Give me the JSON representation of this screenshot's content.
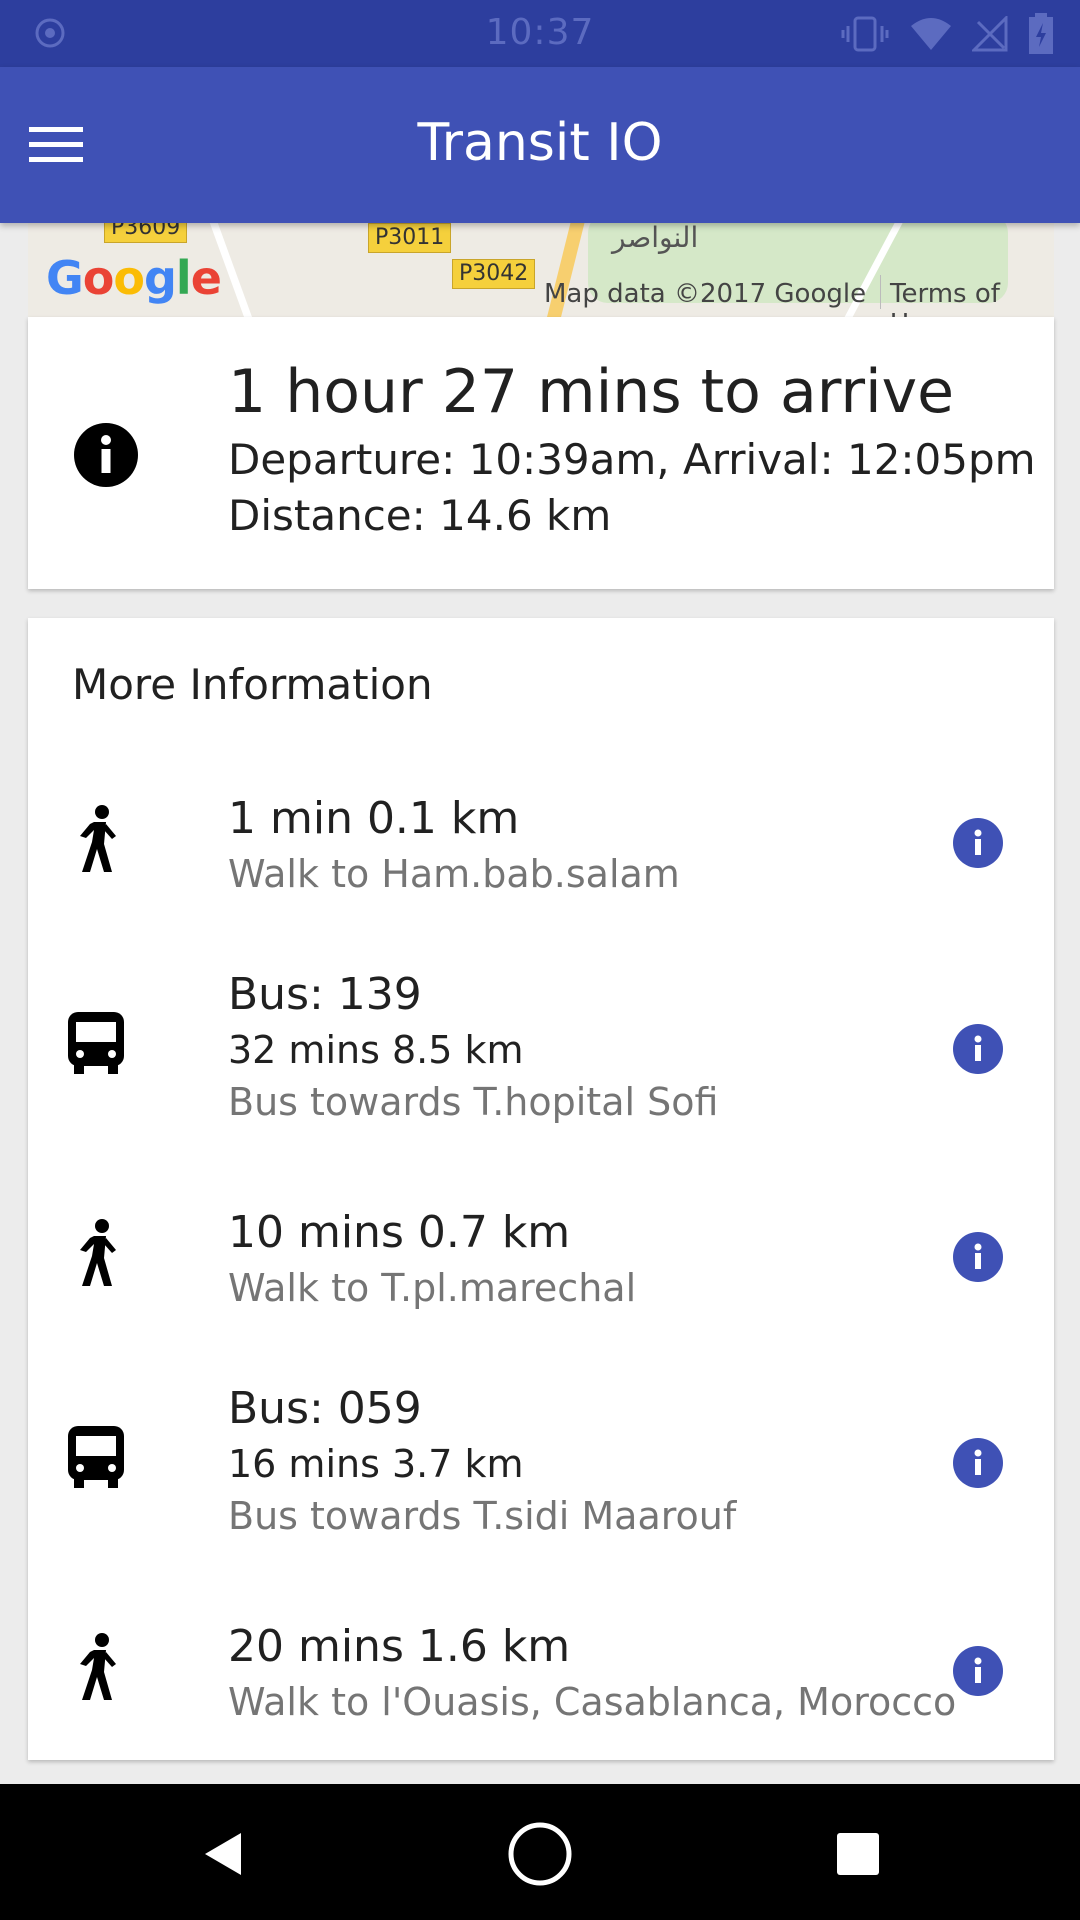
{
  "status_bar": {
    "time": "10:37"
  },
  "app_bar": {
    "title": "Transit IO"
  },
  "map": {
    "road_labels": [
      "P3609",
      "P3011",
      "P3042"
    ],
    "place_label": "النواصر",
    "google_letters": [
      "G",
      "o",
      "o",
      "g",
      "l",
      "e"
    ],
    "attribution": "Map data ©2017 Google",
    "terms": "Terms of Use"
  },
  "summary": {
    "duration": "1 hour 27 mins to arrive",
    "times": "Departure: 10:39am, Arrival: 12:05pm",
    "distance": "Distance: 14.6 km"
  },
  "more_info": {
    "title": "More Information",
    "steps": [
      {
        "icon": "walk-icon",
        "line1": "1 min 0.1 km",
        "line2": "Walk to Ham.bab.salam"
      },
      {
        "icon": "bus-icon",
        "line1": "Bus: 139",
        "line2": "32 mins 8.5 km",
        "line3": "Bus towards T.hopital Sofi"
      },
      {
        "icon": "walk-icon",
        "line1": "10 mins 0.7 km",
        "line2": "Walk to T.pl.marechal"
      },
      {
        "icon": "bus-icon",
        "line1": "Bus: 059",
        "line2": "16 mins 3.7 km",
        "line3": "Bus towards T.sidi Maarouf"
      },
      {
        "icon": "walk-icon",
        "line1": "20 mins 1.6 km",
        "line2": "Walk to l'Ouasis, Casablanca, Morocco"
      }
    ]
  },
  "colors": {
    "primary": "#3f51b5",
    "primary_dark": "#2d3e9e",
    "accent_info": "#3f51b5",
    "text_primary": "#212121",
    "text_secondary": "#757575"
  }
}
